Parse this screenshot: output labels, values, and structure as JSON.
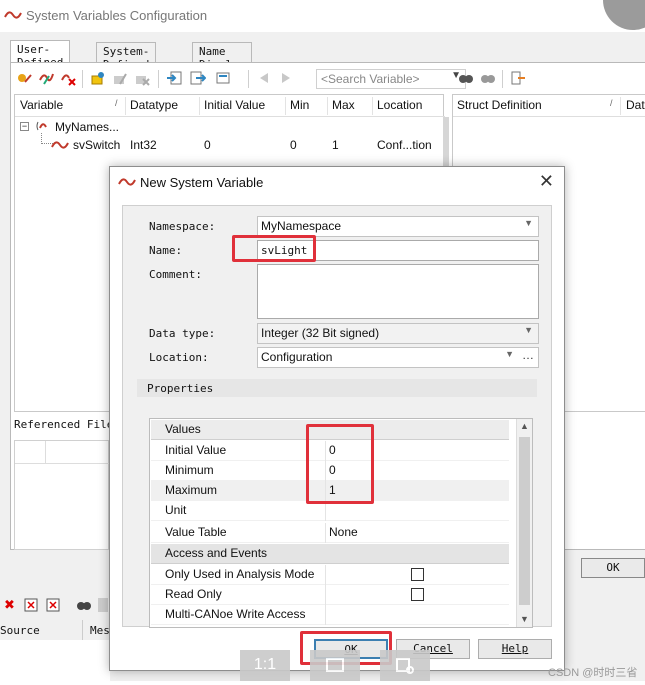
{
  "window": {
    "title": "System Variables Configuration",
    "tabs": [
      "User-Defined",
      "System-Defined",
      "Name Display"
    ],
    "search": {
      "placeholder": "<Search Variable>"
    },
    "grid": {
      "columns": [
        "Variable",
        "Datatype",
        "Initial Value",
        "Min",
        "Max",
        "Location"
      ],
      "rows": [
        {
          "variable": "MyNames...",
          "datatype": "",
          "initial": "",
          "min": "",
          "max": "",
          "location": ""
        },
        {
          "variable": "svSwitch",
          "datatype": "Int32",
          "initial": "0",
          "min": "0",
          "max": "1",
          "location": "Conf...tion"
        }
      ]
    },
    "struct_columns": [
      "Struct Definition",
      "Dat"
    ],
    "referenced_files_label": "Referenced File",
    "ok_label": "OK",
    "bottom_columns": [
      "Source",
      "Mes"
    ]
  },
  "dialog": {
    "title": "New System Variable",
    "fields": {
      "namespace_label": "Namespace:",
      "namespace_value": "MyNamespace",
      "name_label": "Name:",
      "name_value": "svLight",
      "comment_label": "Comment:",
      "comment_value": "",
      "datatype_label": "Data type:",
      "datatype_value": "Integer (32 Bit signed)",
      "location_label": "Location:",
      "location_value": "Configuration"
    },
    "properties_label": "Properties",
    "sections": {
      "values": "Values",
      "access": "Access and Events"
    },
    "values_rows": [
      {
        "name": "Initial Value",
        "value": "0"
      },
      {
        "name": "Minimum",
        "value": "0"
      },
      {
        "name": "Maximum",
        "value": "1"
      },
      {
        "name": "Unit",
        "value": ""
      },
      {
        "name": "Value Table",
        "value": "None"
      }
    ],
    "access_rows": [
      {
        "name": "Only Used in Analysis Mode",
        "checked": false
      },
      {
        "name": "Read Only",
        "checked": false
      },
      {
        "name": "Multi-CANoe Write Access",
        "checked": false
      }
    ],
    "buttons": {
      "ok": "OK",
      "cancel": "Cancel",
      "help": "Help"
    }
  },
  "viewer": {
    "actual_size": "1:1"
  },
  "watermark": "CSDN @时时三省",
  "colors": {
    "highlight": "#e0303a",
    "accent": "#3c7fb1"
  }
}
